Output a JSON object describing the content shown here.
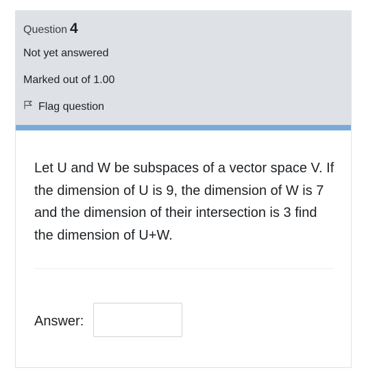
{
  "info": {
    "question_label": "Question",
    "question_number": "4",
    "state": "Not yet answered",
    "grade": "Marked out of 1.00",
    "flag_label": "Flag question"
  },
  "question": {
    "text": "Let U and W be subspaces of a vector space V. If the dimension of U is 9, the dimension of W is 7 and the dimension of their intersection is 3 find the dimension of  U+W."
  },
  "answer": {
    "label": "Answer:",
    "value": ""
  },
  "icons": {
    "flag": "flag-icon"
  },
  "colors": {
    "info_background": "#dee2e6",
    "accent_bar": "#7aaad7"
  }
}
